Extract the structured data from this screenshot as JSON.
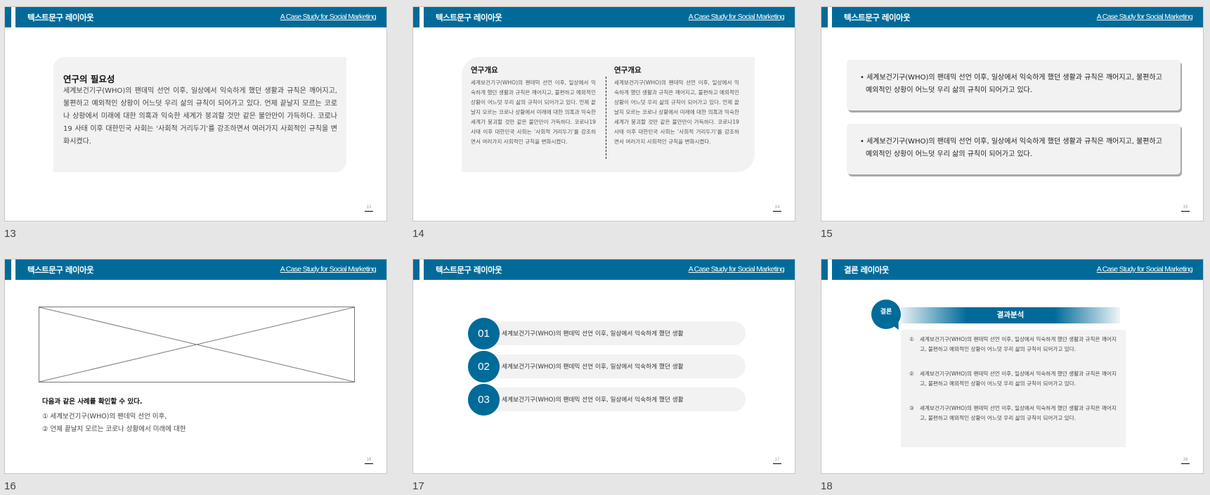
{
  "header": {
    "title_text_layout": "텍스트문구 레이아웃",
    "title_conclusion_layout": "결론 레이아웃",
    "link": "A Case Study for Social Marketing"
  },
  "slides": [
    {
      "number": "13",
      "box_title": "연구의 필요성",
      "box_body": "세계보건기구(WHO)의 팬데믹 선언 이후,  일상에서 익숙하게 했던 생활과 규칙은 깨어지고, 불편하고 예외적인 상황이 어느덧 우리 삶의 규칙이 되어가고 있다. 언제 끝날지 모르는 코로나 상황에서 미래에 대한 의혹과 익숙한 세계가 붕괴할 것만 같은 불안만이 가득하다. 코로나19 사태 이후 대한민국 사회는 ‘사회적 거리두기’를 강조하면서 여러가지 사회적인 규칙을 변화시켰다."
    },
    {
      "number": "14",
      "columns": [
        {
          "title": "연구개요",
          "body": "세계보건기구(WHO)의 팬데믹 선언 이후,  일상에서 익숙하게 했던 생활과 규칙은 깨어지고, 불편하고 예외적인 상황이 어느덧 우리 삶의 규칙이 되어가고 있다. 언제 끝날지 모르는 코로나 상황에서 미래에 대한 의혹과 익숙한 세계가 붕괴할 것만 같은 불안만이 가득하다. 코로나19 사태 이후 대한민국 사회는 ‘사회적 거리두기’를 강조하면서 여러가지 사회적인 규칙을 변화시켰다."
        },
        {
          "title": "연구개요",
          "body": "세계보건기구(WHO)의 팬데믹 선언 이후,  일상에서 익숙하게 했던 생활과 규칙은 깨어지고, 불편하고 예외적인 상황이 어느덧 우리 삶의 규칙이 되어가고 있다. 언제 끝날지 모르는 코로나 상황에서 미래에 대한 의혹과 익숙한 세계가 붕괴할 것만 같은 불안만이 가득하다. 코로나19 사태 이후 대한민국 사회는 ‘사회적 거리두기’를 강조하면서 여러가지 사회적인 규칙을 변화시켰다."
        }
      ]
    },
    {
      "number": "15",
      "bullets": [
        "• 세계보건기구(WHO)의 팬데믹 선언 이후,  일상에서 익숙하게 했던 생활과 규칙은 깨어지고, 불편하고 예외적인 상황이 어느덧 우리 삶의 규칙이 되어가고 있다.",
        "• 세계보건기구(WHO)의 팬데믹 선언 이후,  일상에서 익숙하게 했던 생활과 규칙은 깨어지고, 불편하고 예외적인 상황이 어느덧 우리 삶의 규칙이 되어가고 있다."
      ]
    },
    {
      "number": "16",
      "heading": "다음과 같은 사례를 확인할 수 있다.",
      "items": [
        "① 세계보건기구(WHO)의 팬데믹 선언 이후,",
        "② 언제 끝날지 모르는 코로나 상황에서 미래에 대한"
      ]
    },
    {
      "number": "17",
      "steps": [
        {
          "num": "01",
          "text": "세계보건기구(WHO)의 팬데믹 선언 이후,  일상에서 익숙하게 했던 생활"
        },
        {
          "num": "02",
          "text": "세계보건기구(WHO)의 팬데믹 선언 이후,  일상에서 익숙하게 했던 생활"
        },
        {
          "num": "03",
          "text": "세계보건기구(WHO)의 팬데믹 선언 이후,  일상에서 익숙하게 했던 생활"
        }
      ]
    },
    {
      "number": "18",
      "bubble": "결론",
      "bar_title": "결과분석",
      "items": [
        {
          "n": "①",
          "text": "세계보건기구(WHO)의 팬데믹 선언 이후,  일상에서 익숙하게 했던 생활과 규칙은 깨어지고, 불편하고 예외적인 상황이 어느덧 우리 삶의 규칙이 되어가고 있다."
        },
        {
          "n": "②",
          "text": "세계보건기구(WHO)의 팬데믹 선언 이후,  일상에서 익숙하게 했던 생활과 규칙은 깨어지고, 불편하고 예외적인 상황이 어느덧 우리 삶의 규칙이 되어가고 있다."
        },
        {
          "n": "③",
          "text": "세계보건기구(WHO)의 팬데믹 선언 이후,  일상에서 익숙하게 했던 생활과 규칙은 깨어지고, 불편하고 예외적인 상황이 어느덧 우리 삶의 규칙이 되어가고 있다."
        }
      ]
    }
  ],
  "colors": {
    "brand": "#006b99",
    "panel": "#f2f2f2",
    "background": "#e6e6e6"
  }
}
